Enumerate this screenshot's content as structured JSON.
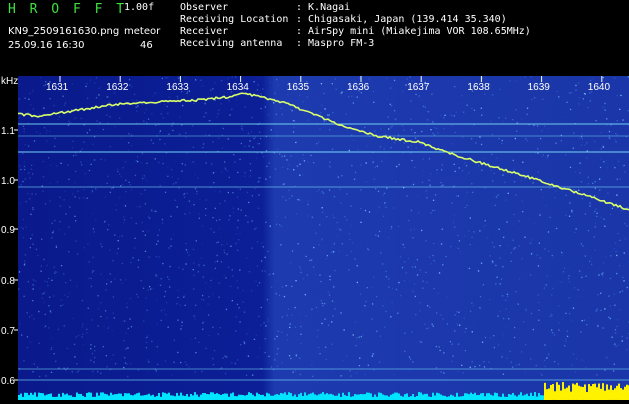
{
  "header": {
    "logo": "H R O F F T",
    "version": "1.00f",
    "filename": "KN9_2509161630.png",
    "datetime": "25.09.16 16:30",
    "meteor_label": "meteor",
    "meteor_count": "46"
  },
  "info": [
    {
      "label": "Observer",
      "value": ": K.Nagai"
    },
    {
      "label": "Receiving Location",
      "value": ": Chigasaki, Japan (139.414 35.340)"
    },
    {
      "label": "Receiver",
      "value": ": AirSpy mini (Miakejima VOR 108.65MHz)"
    },
    {
      "label": "Receiving antenna",
      "value": ": Maspro FM-3"
    }
  ],
  "axis": {
    "unit_label": "kHz",
    "y_ticks": [
      "1.1",
      "1.0",
      "0.9",
      "0.8",
      "0.7",
      "0.6"
    ],
    "x_ticks": [
      "1631",
      "1632",
      "1633",
      "1634",
      "1635",
      "1636",
      "1637",
      "1638",
      "1639",
      "1640"
    ]
  },
  "colors": {
    "background": "#000000",
    "spectrogram_base": "#0a1a8c",
    "trace": "#d8ff6a",
    "carrier_line": "#7fe8ff",
    "noise_floor": "#00e5ff",
    "logo": "#3ee03e"
  }
}
